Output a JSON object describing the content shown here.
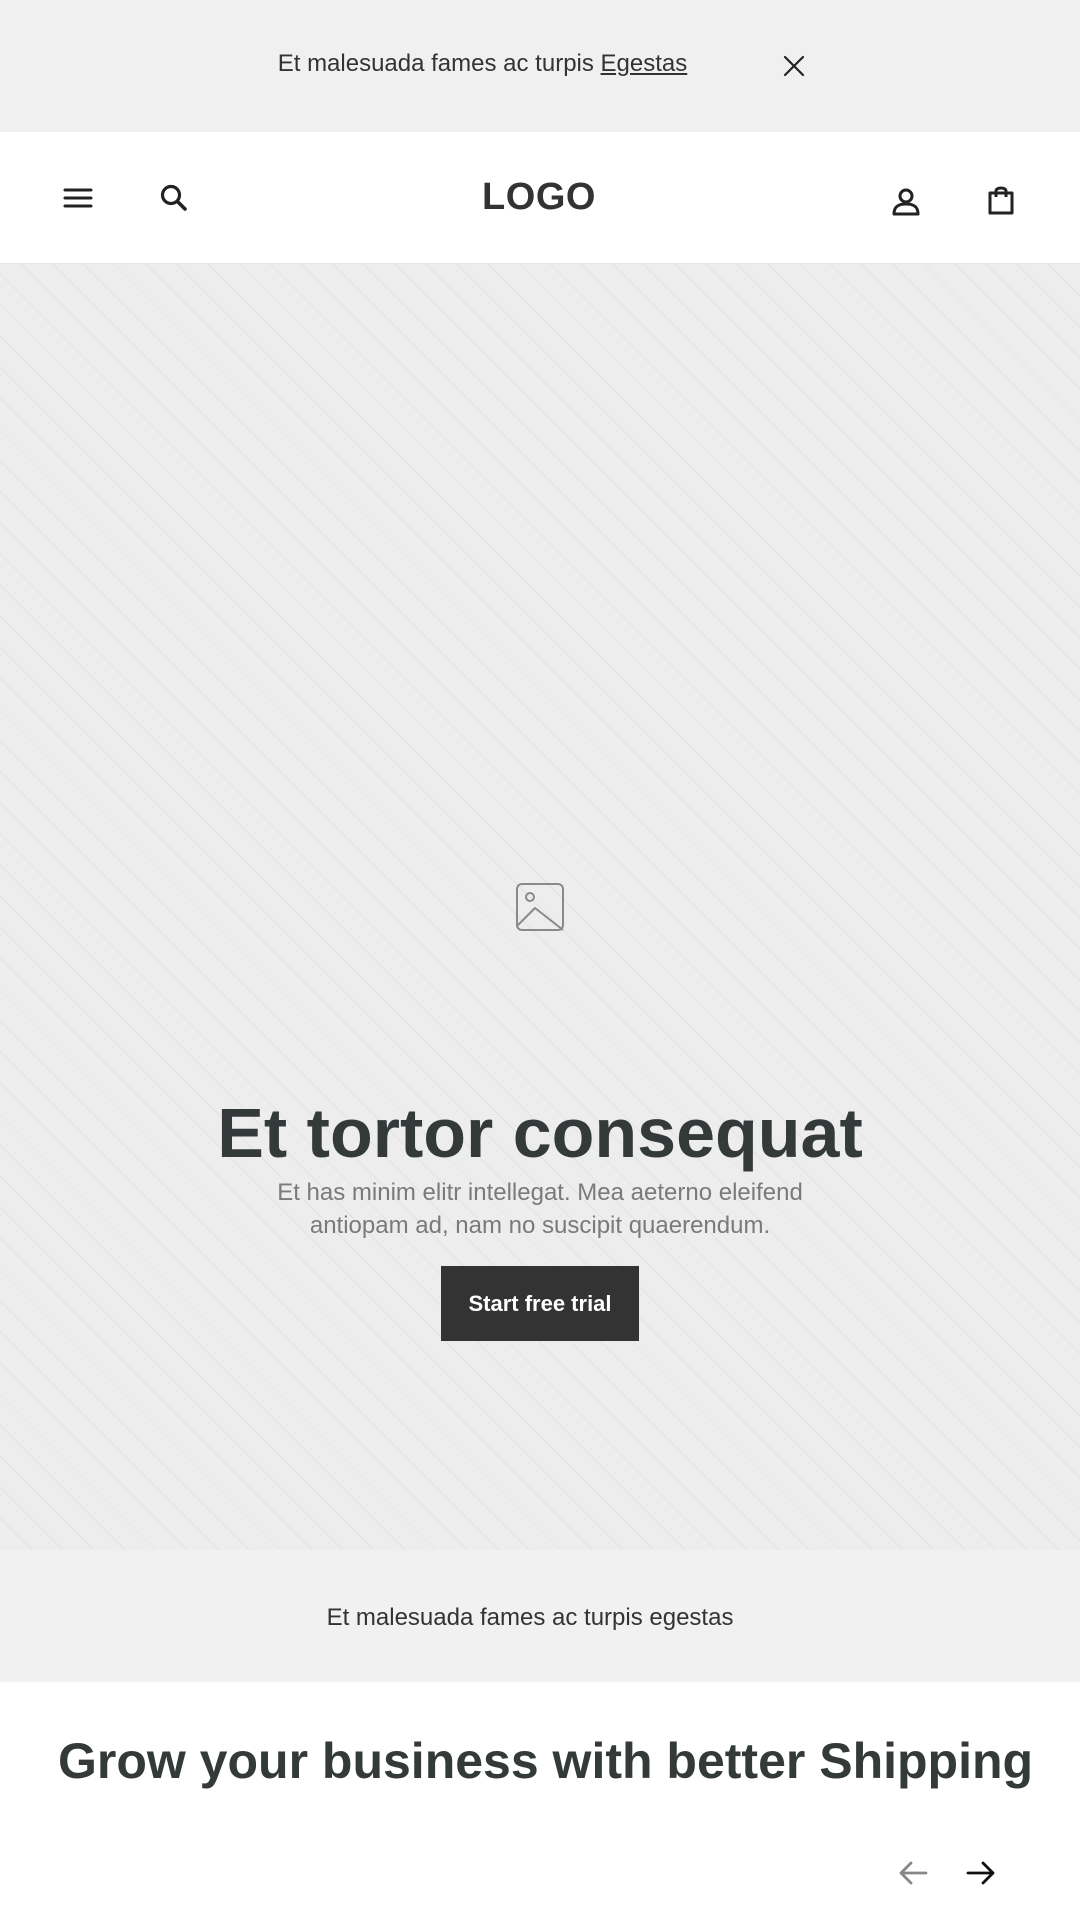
{
  "announcement": {
    "text": "Et malesuada fames ac turpis ",
    "link": "Egestas",
    "close_icon": "close-icon"
  },
  "header": {
    "logo": "LOGO",
    "icons": [
      "menu-icon",
      "search-icon",
      "account-icon",
      "cart-icon"
    ]
  },
  "hero": {
    "image_icon": "image-placeholder-icon",
    "title": "Et tortor consequat",
    "subtitle": "Et has minim elitr intellegat. Mea aeterno eleifend antiopam ad, nam no suscipit quaerendum.",
    "button_label": "Start free trial"
  },
  "strip": {
    "text": "Et malesuada fames ac turpis egestas"
  },
  "section": {
    "title": "Grow your business with better Shipping"
  },
  "carousel": {
    "icons": [
      "arrow-left-icon",
      "arrow-right-icon"
    ]
  },
  "colors": {
    "announcement_bg": "#f0f0f0",
    "hero_bg": "#ededed",
    "button_bg": "#333333",
    "text_dark": "#343a3a",
    "text_muted": "#7a7a7a"
  }
}
